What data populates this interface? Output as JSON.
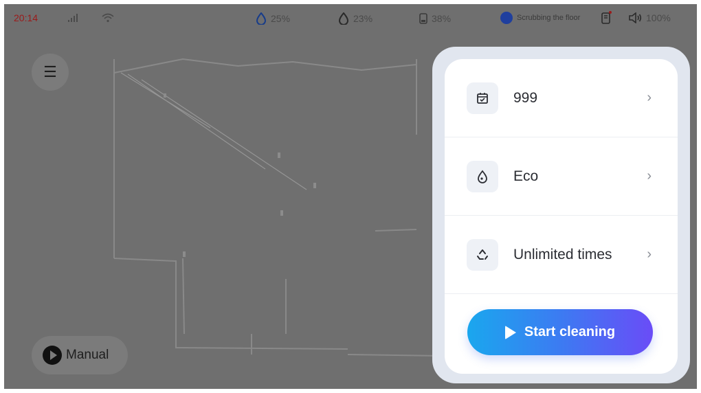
{
  "status_bar": {
    "time": "20:14",
    "clean_water": "25%",
    "dirty_water": "23%",
    "battery": "38%",
    "task": "Scrubbing the floor",
    "volume": "100%"
  },
  "map": {
    "manual_label": "Manual"
  },
  "panel": {
    "rows": [
      {
        "label": "999",
        "icon": "calendar-check-icon"
      },
      {
        "label": "Eco",
        "icon": "water-drop-icon"
      },
      {
        "label": "Unlimited times",
        "icon": "recycle-icon"
      }
    ],
    "start_label": "Start cleaning"
  },
  "colors": {
    "overlay": "#6f6f6f",
    "panel_border": "#e1e6ef",
    "start_gradient_from": "#1aa7ee",
    "start_gradient_to": "#6a4cf7",
    "time_color": "#9b1a1a"
  }
}
